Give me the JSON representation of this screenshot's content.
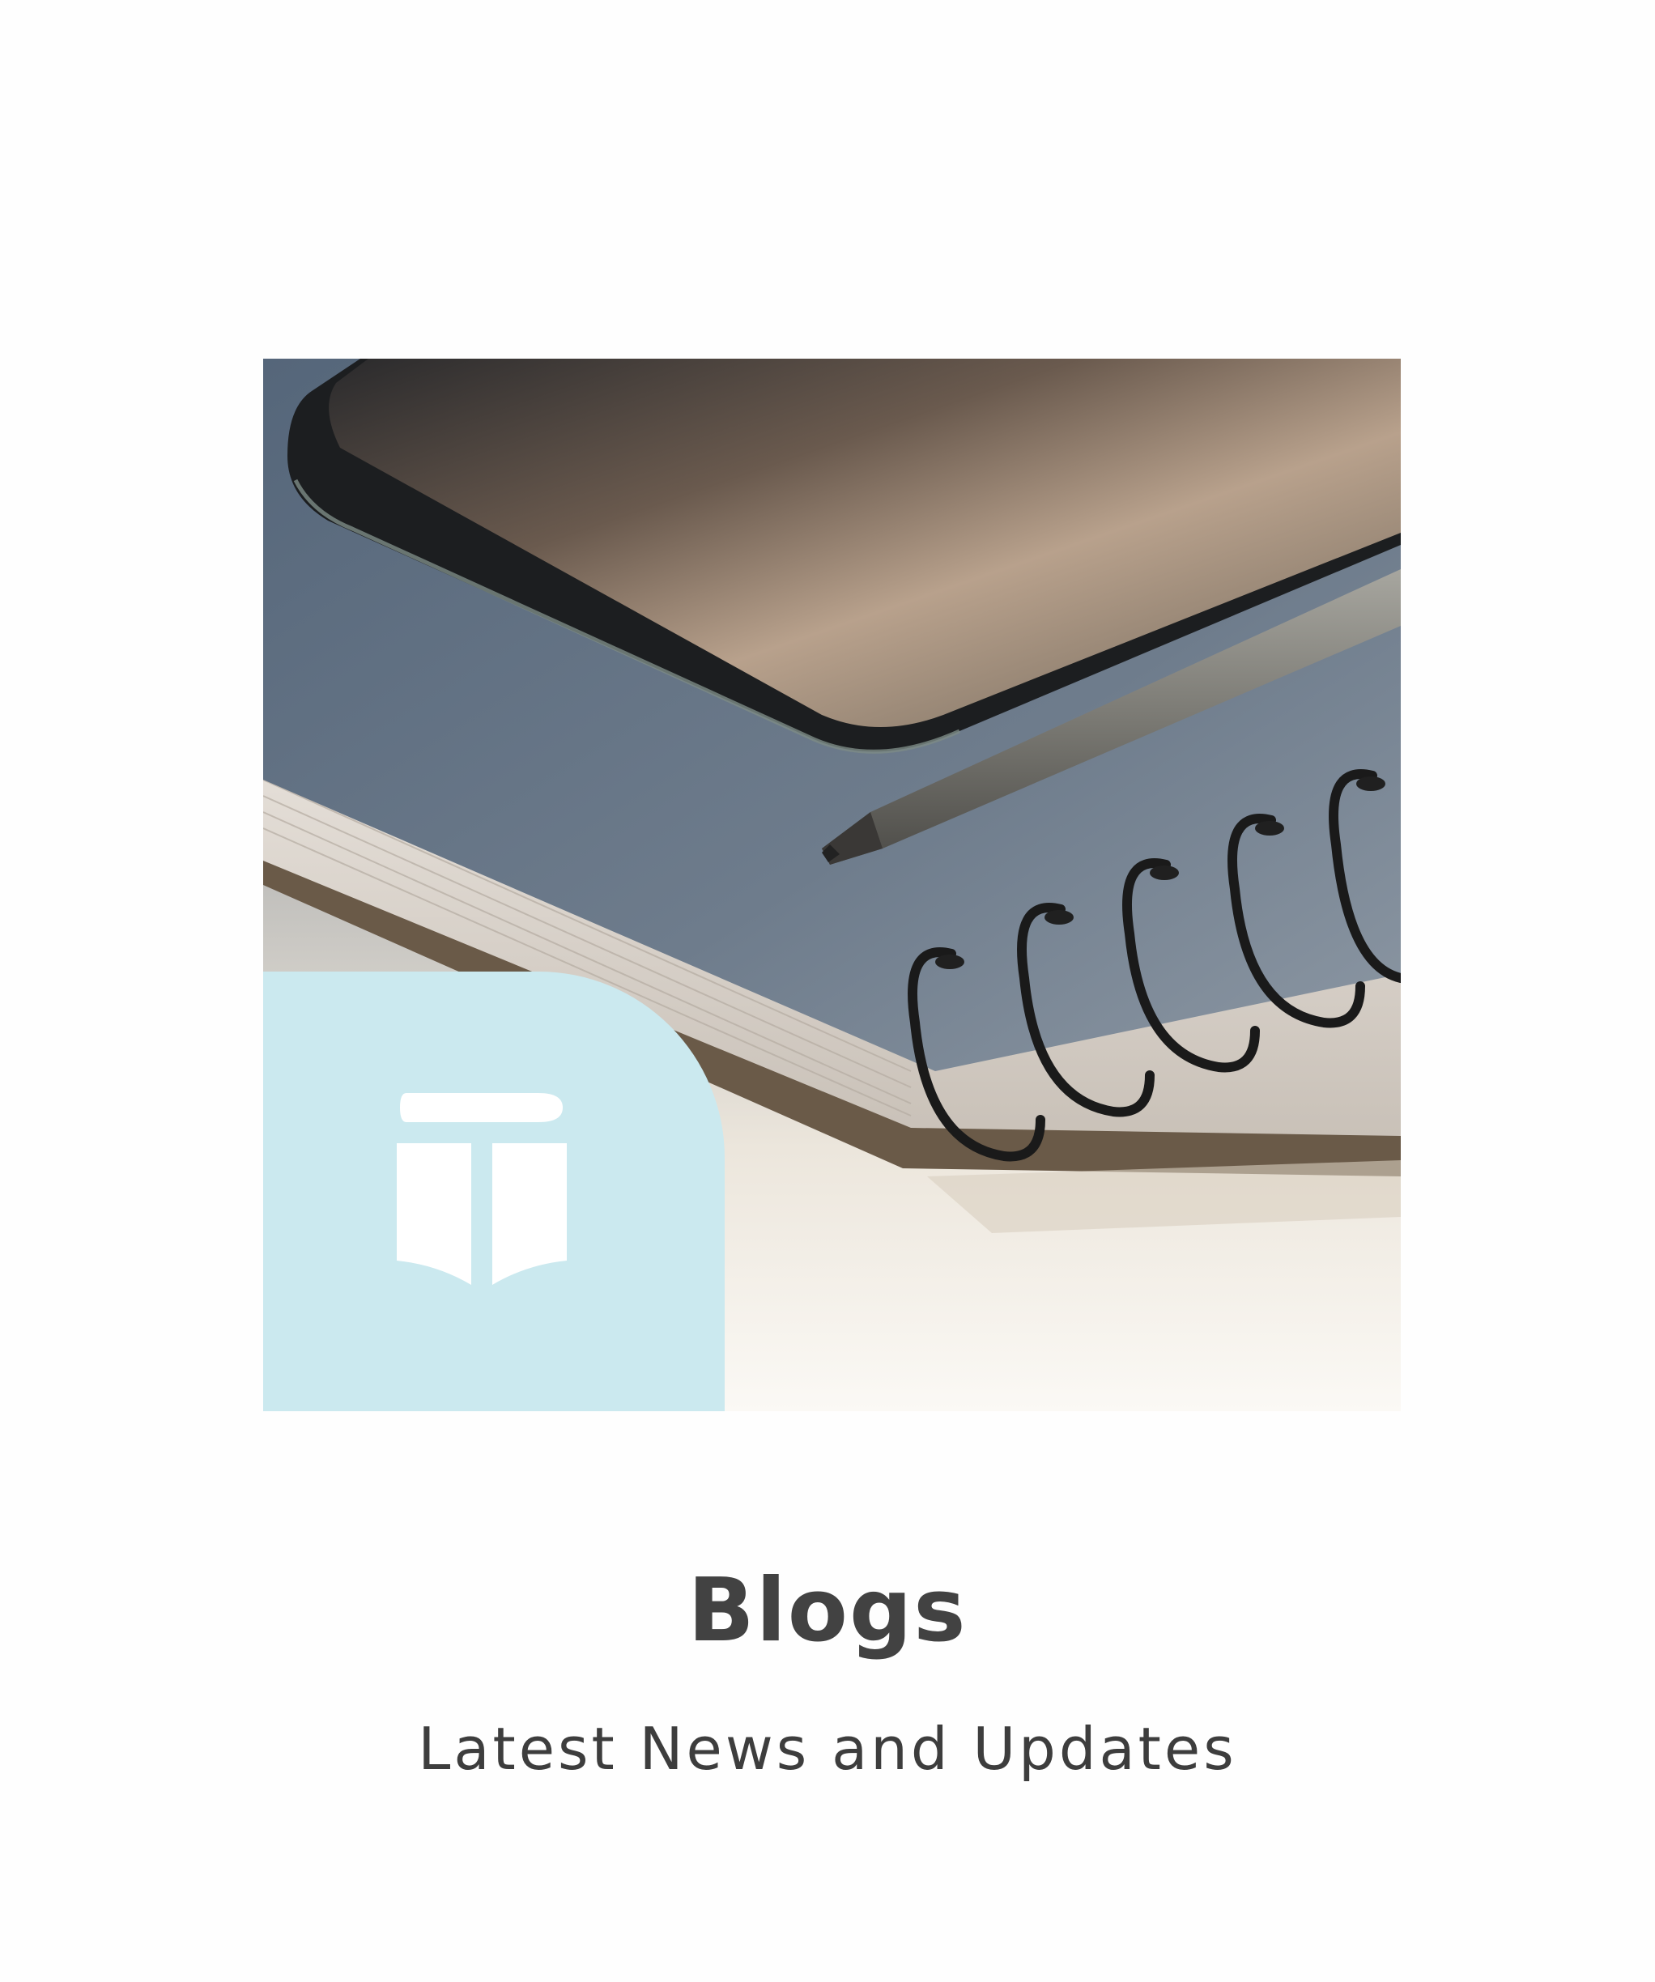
{
  "card": {
    "title": "Blogs",
    "subtitle": "Latest News and Updates",
    "image_subject": "notebook-phone-pencil-photo",
    "badge_icon": "open-book-pencil-icon",
    "badge_color": "#cbe9ef",
    "title_color": "#424242",
    "subtitle_color": "#3d3d3d"
  }
}
